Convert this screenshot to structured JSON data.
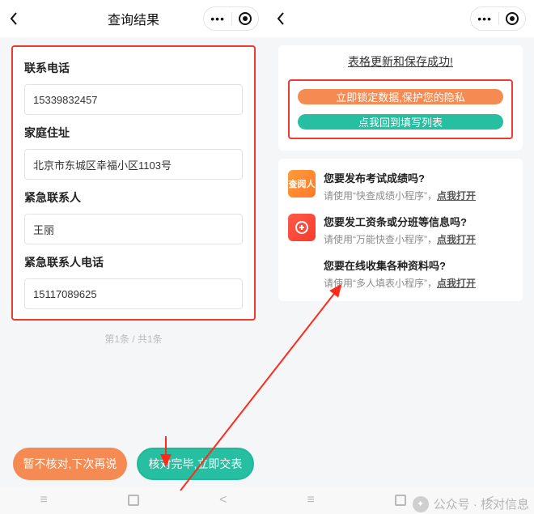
{
  "left": {
    "title": "查询结果",
    "fields": [
      {
        "label": "联系电话",
        "value": "15339832457"
      },
      {
        "label": "家庭住址",
        "value": "北京市东城区幸福小区1103号"
      },
      {
        "label": "紧急联系人",
        "value": "王丽"
      },
      {
        "label": "紧急联系人电话",
        "value": "15117089625"
      }
    ],
    "paging": "第1条 / 共1条",
    "actions": {
      "cancel": "暂不核对,下次再说",
      "submit": "核对完毕,立即交表"
    }
  },
  "right": {
    "success": "表格更新和保存成功!",
    "btn_lock": "立即锁定数据,保护您的隐私",
    "btn_back": "点我回到填写列表",
    "promos": [
      {
        "icon": "orange",
        "icon_text": "查阅人",
        "title": "您要发布考试成绩吗?",
        "sub_pre": "请使用“快查成绩小程序”，",
        "link": "点我打开"
      },
      {
        "icon": "red",
        "icon_text": "",
        "title": "您要发工资条或分班等信息吗?",
        "sub_pre": "请使用“万能快查小程序”，",
        "link": "点我打开"
      },
      {
        "icon": "multi",
        "icon_text": "",
        "title": "您要在线收集各种资料吗?",
        "sub_pre": "请使用“多人填表小程序”，",
        "link": "点我打开"
      }
    ]
  },
  "watermark": "公众号 · 核对信息"
}
